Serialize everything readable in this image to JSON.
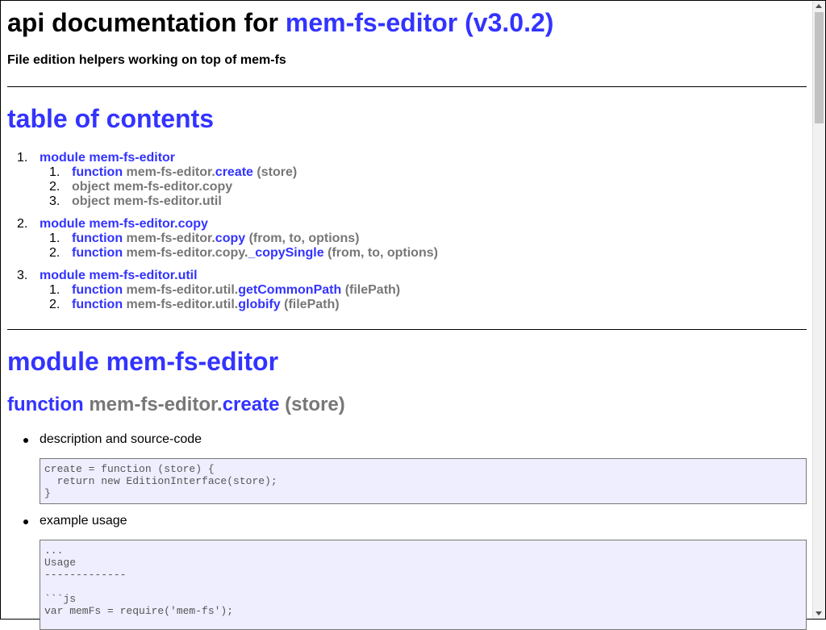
{
  "header": {
    "title_prefix": "api documentation for ",
    "title_link": "mem-fs-editor (v3.0.2)",
    "subtitle": "File edition helpers working on top of mem-fs"
  },
  "toc": {
    "title": "table of contents",
    "modules": [
      {
        "num": "1.",
        "label": "module mem-fs-editor",
        "items": [
          {
            "num": "1.",
            "kind": "function",
            "prefix": "mem-fs-editor.",
            "name": "create",
            "args": "(store)"
          },
          {
            "num": "2.",
            "kind": "object",
            "prefix": "mem-fs-editor.copy",
            "name": "",
            "args": ""
          },
          {
            "num": "3.",
            "kind": "object",
            "prefix": "mem-fs-editor.util",
            "name": "",
            "args": ""
          }
        ]
      },
      {
        "num": "2.",
        "label": "module mem-fs-editor.copy",
        "items": [
          {
            "num": "1.",
            "kind": "function",
            "prefix": "mem-fs-editor.",
            "name": "copy",
            "args": "(from, to, options)"
          },
          {
            "num": "2.",
            "kind": "function",
            "prefix": "mem-fs-editor.copy.",
            "name": "_copySingle",
            "args": "(from, to, options)"
          }
        ]
      },
      {
        "num": "3.",
        "label": "module mem-fs-editor.util",
        "items": [
          {
            "num": "1.",
            "kind": "function",
            "prefix": "mem-fs-editor.util.",
            "name": "getCommonPath",
            "args": "(filePath)"
          },
          {
            "num": "2.",
            "kind": "function",
            "prefix": "mem-fs-editor.util.",
            "name": "globify",
            "args": "(filePath)"
          }
        ]
      }
    ]
  },
  "section": {
    "module_title": "module mem-fs-editor",
    "fn_kind": "function",
    "fn_prefix": "mem-fs-editor.",
    "fn_name": "create",
    "fn_args": "(store)",
    "desc_label": "description and source-code",
    "source": "create = function (store) {\n  return new EditionInterface(store);\n}",
    "example_label": "example usage",
    "example": "...\nUsage\n-------------\n\n```js\nvar memFs = require('mem-fs');"
  }
}
